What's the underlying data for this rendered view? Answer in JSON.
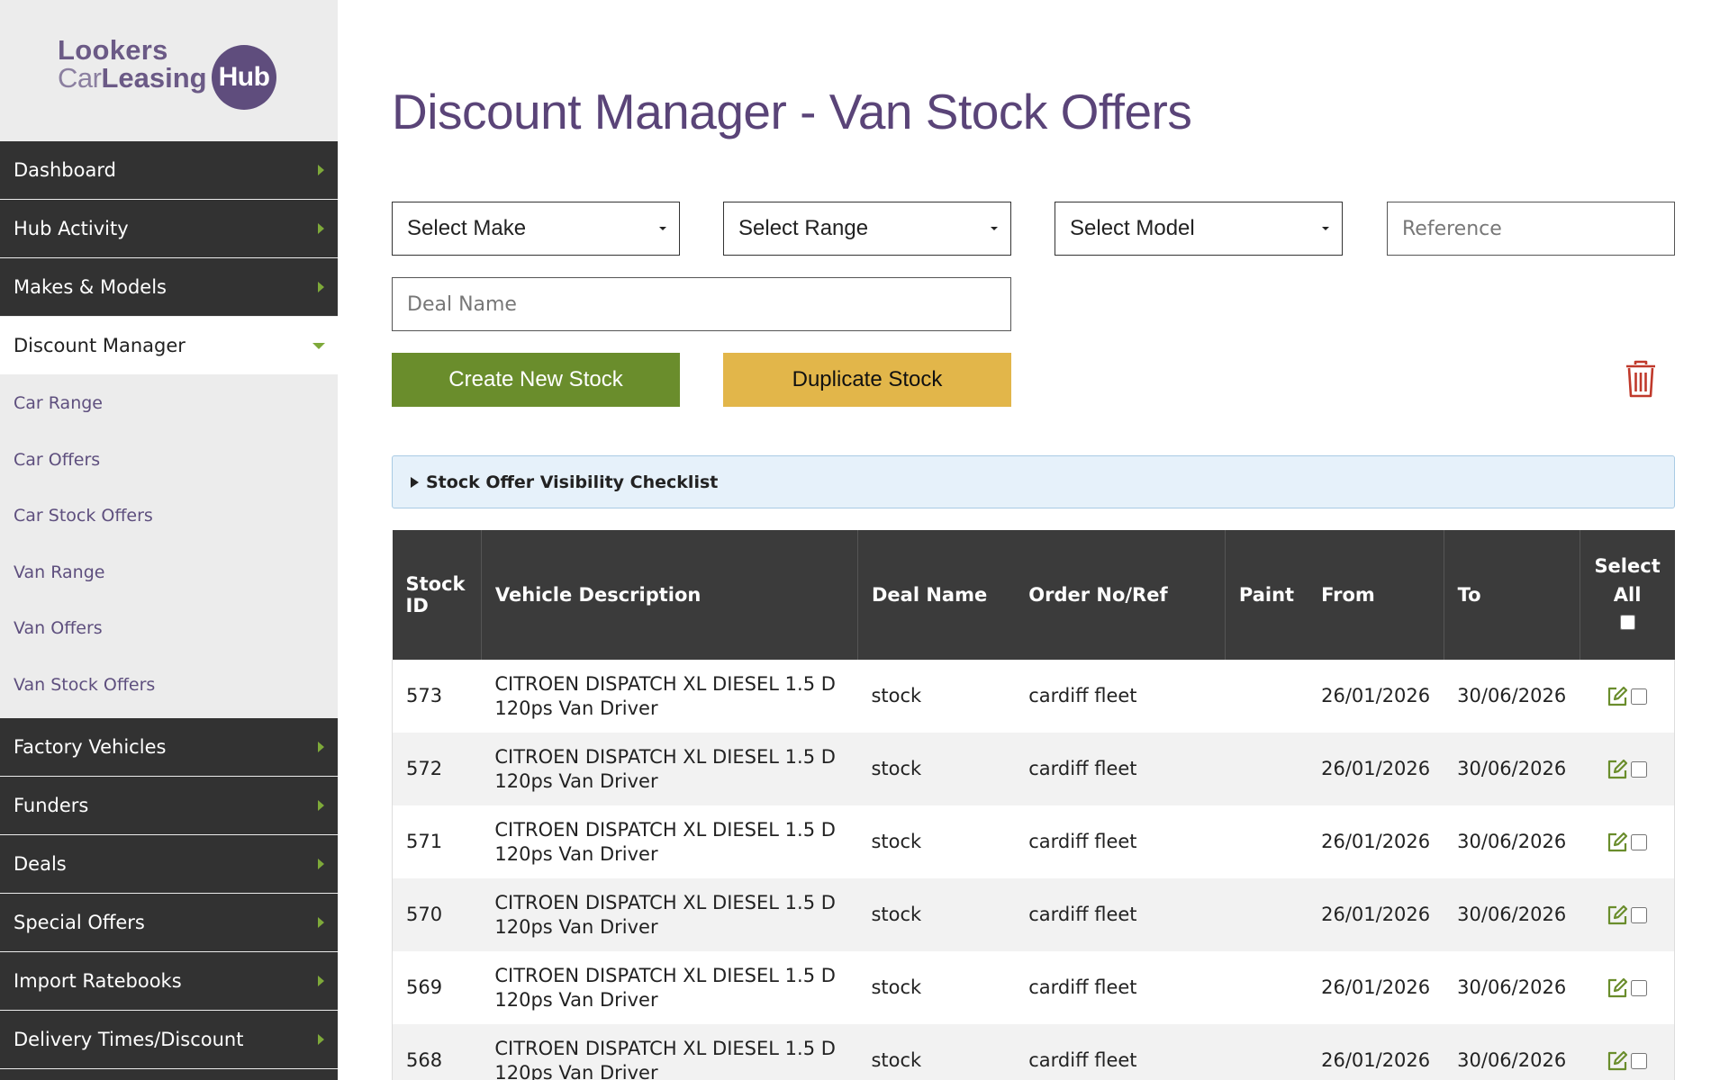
{
  "logo": {
    "line1": "Lookers",
    "line2_car": "Car",
    "line2_leasing": "Leasing",
    "hub": "Hub"
  },
  "sidebar": {
    "items_top": [
      {
        "label": "Dashboard"
      },
      {
        "label": "Hub Activity"
      },
      {
        "label": "Makes & Models"
      }
    ],
    "active": {
      "label": "Discount Manager"
    },
    "sub_items": [
      {
        "label": "Car Range"
      },
      {
        "label": "Car Offers"
      },
      {
        "label": "Car Stock Offers"
      },
      {
        "label": "Van Range"
      },
      {
        "label": "Van Offers"
      },
      {
        "label": "Van Stock Offers"
      }
    ],
    "items_bottom": [
      {
        "label": "Factory Vehicles"
      },
      {
        "label": "Funders"
      },
      {
        "label": "Deals"
      },
      {
        "label": "Special Offers"
      },
      {
        "label": "Import Ratebooks"
      },
      {
        "label": "Delivery Times/Discount"
      }
    ]
  },
  "page": {
    "title": "Discount Manager - Van Stock Offers"
  },
  "filters": {
    "make": "Select Make",
    "range": "Select Range",
    "model": "Select Model",
    "reference_placeholder": "Reference",
    "deal_name_placeholder": "Deal Name"
  },
  "buttons": {
    "create": "Create New Stock",
    "duplicate": "Duplicate Stock"
  },
  "checklist": {
    "label": "Stock Offer Visibility Checklist"
  },
  "table": {
    "headers": {
      "stock_id_1": "Stock",
      "stock_id_2": "ID",
      "vehicle": "Vehicle Description",
      "deal": "Deal Name",
      "order": "Order No/Ref",
      "paint": "Paint",
      "from": "From",
      "to": "To",
      "select_all_1": "Select",
      "select_all_2": "All"
    },
    "rows": [
      {
        "id": "573",
        "desc1": "CITROEN DISPATCH XL DIESEL 1.5 D",
        "desc2": "120ps Van Driver",
        "deal": "stock",
        "order": "cardiff fleet",
        "paint": "",
        "from": "26/01/2026",
        "to": "30/06/2026"
      },
      {
        "id": "572",
        "desc1": "CITROEN DISPATCH XL DIESEL 1.5 D",
        "desc2": "120ps Van Driver",
        "deal": "stock",
        "order": "cardiff fleet",
        "paint": "",
        "from": "26/01/2026",
        "to": "30/06/2026"
      },
      {
        "id": "571",
        "desc1": "CITROEN DISPATCH XL DIESEL 1.5 D",
        "desc2": "120ps Van Driver",
        "deal": "stock",
        "order": "cardiff fleet",
        "paint": "",
        "from": "26/01/2026",
        "to": "30/06/2026"
      },
      {
        "id": "570",
        "desc1": "CITROEN DISPATCH XL DIESEL 1.5 D",
        "desc2": "120ps Van Driver",
        "deal": "stock",
        "order": "cardiff fleet",
        "paint": "",
        "from": "26/01/2026",
        "to": "30/06/2026"
      },
      {
        "id": "569",
        "desc1": "CITROEN DISPATCH XL DIESEL 1.5 D",
        "desc2": "120ps Van Driver",
        "deal": "stock",
        "order": "cardiff fleet",
        "paint": "",
        "from": "26/01/2026",
        "to": "30/06/2026"
      },
      {
        "id": "568",
        "desc1": "CITROEN DISPATCH XL DIESEL 1.5 D",
        "desc2": "120ps Van Driver",
        "deal": "stock",
        "order": "cardiff fleet",
        "paint": "",
        "from": "26/01/2026",
        "to": "30/06/2026"
      }
    ]
  },
  "colors": {
    "brand_purple": "#5a4478",
    "nav_dark": "#323232",
    "accent_green": "#6a8d2c",
    "accent_yellow": "#e2b64a",
    "delete_red": "#c0392b",
    "edit_green": "#6a8d2c"
  },
  "icons": {
    "nav_arrow": "chevron-right-icon",
    "delete": "trash-icon",
    "edit": "edit-icon"
  }
}
